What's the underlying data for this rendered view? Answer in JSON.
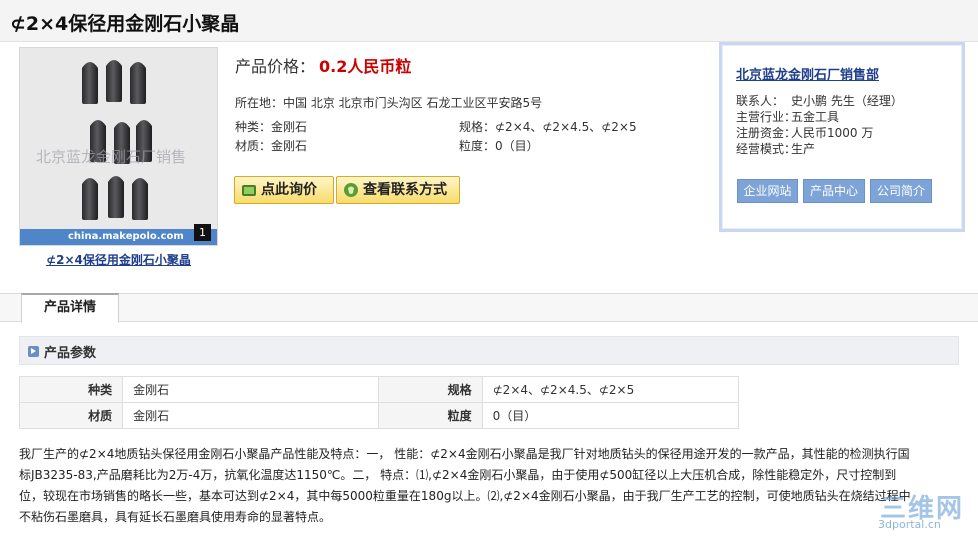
{
  "product": {
    "title": "⊄2×4保径用金刚石小聚晶",
    "image": {
      "watermark": "北京蓝龙金刚石厂销售",
      "site": "china.makepolo.com",
      "index": "1",
      "caption": "⊄2×4保径用金刚石小聚晶"
    },
    "price_label": "产品价格：",
    "price_value": "0.2人民币粒",
    "location": "所在地：中国 北京 北京市门头沟区 石龙工业区平安路5号",
    "attrs": {
      "kind": "种类：金刚石",
      "spec": "规格：⊄2×4、⊄2×4.5、⊄2×5",
      "material": "材质：金刚石",
      "grain": "粒度：0（目）"
    },
    "buttons": {
      "inquire": "点此询价",
      "contact": "查看联系方式"
    }
  },
  "company": {
    "name": "北京蓝龙金刚石厂销售部",
    "rows": [
      {
        "k": "联系人：",
        "v": "史小鹏 先生（经理）"
      },
      {
        "k": "主营行业：",
        "v": "五金工具"
      },
      {
        "k": "注册资金：",
        "v": "人民币1000 万"
      },
      {
        "k": "经营模式：",
        "v": "生产"
      }
    ],
    "links": [
      "企业网站",
      "产品中心",
      "公司简介"
    ]
  },
  "tabs": [
    "产品详情"
  ],
  "params": {
    "heading": "产品参数",
    "rows": [
      [
        "种类",
        "金刚石",
        "规格",
        "⊄2×4、⊄2×4.5、⊄2×5"
      ],
      [
        "材质",
        "金刚石",
        "粒度",
        "0（目）"
      ]
    ]
  },
  "description": "我厂生产的⊄2×4地质钻头保径用金刚石小聚晶产品性能及特点：一， 性能：⊄2×4金刚石小聚晶是我厂针对地质钻头的保径用途开发的一款产品，其性能的检测执行国标JB3235-83,产品磨耗比为2万-4万，抗氧化温度达1150℃。二， 特点：⑴,⊄2×4金刚石小聚晶，由于使用⊄500缸径以上大压机合成，除性能稳定外，尺寸控制到位，较现在市场销售的略长一些，基本可达到⊄2×4，其中每5000粒重量在180g以上。⑵,⊄2×4金刚石小聚晶，由于我厂生产工艺的控制，可使地质钻头在烧结过程中不粘伤石墨磨具，具有延长石墨磨具使用寿命的显著特点。",
  "watermark_logo": {
    "big": "三维网",
    "small": "3dportal.cn"
  }
}
